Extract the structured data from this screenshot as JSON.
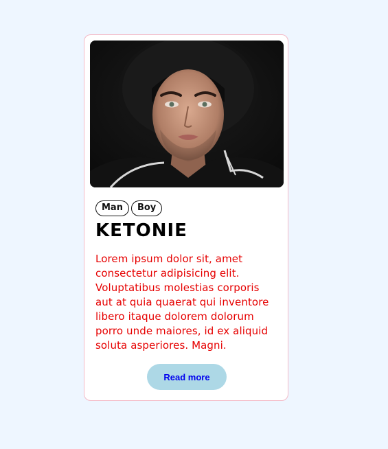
{
  "card": {
    "image_alt": "portrait of young man wearing black hat",
    "tags": [
      "Man",
      "Boy"
    ],
    "name": "KETONIE",
    "description": "Lorem ipsum dolor sit, amet consectetur adipisicing elit. Voluptatibus molestias corporis aut at quia quaerat qui inventore libero itaque dolorem dolorum porro unde maiores, id ex aliquid soluta asperiores. Magni.",
    "button_label": "Read more"
  },
  "colors": {
    "page_background": "#eef6ff",
    "card_border": "#f3b9c6",
    "description_text": "#e60000",
    "button_background": "#add8e6",
    "button_text": "#0000ee"
  }
}
